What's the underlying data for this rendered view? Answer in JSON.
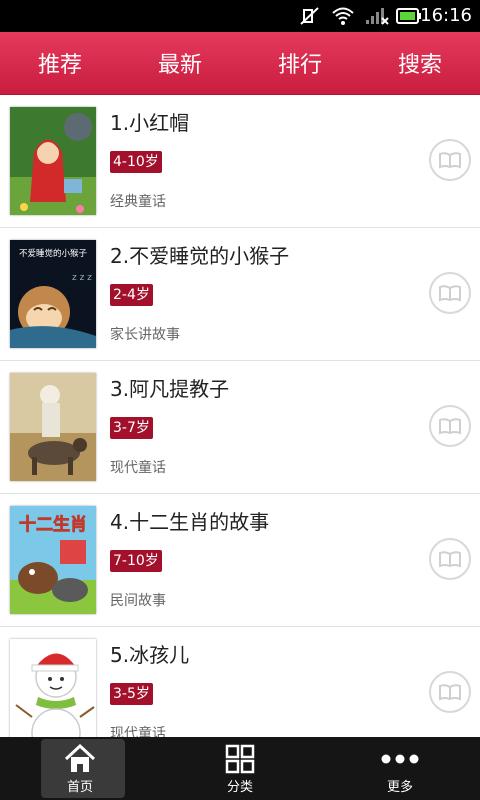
{
  "status_bar": {
    "time": "16:16",
    "icons": [
      "mute-icon",
      "wifi-icon",
      "signal-icon",
      "battery-icon"
    ]
  },
  "top_tabs": [
    {
      "label": "推荐"
    },
    {
      "label": "最新"
    },
    {
      "label": "排行"
    },
    {
      "label": "搜索"
    }
  ],
  "stories": [
    {
      "title": "1.小红帽",
      "age": "4-10岁",
      "category": "经典童话"
    },
    {
      "title": "2.不爱睡觉的小猴子",
      "age": "2-4岁",
      "category": "家长讲故事",
      "cover_text": "不爱睡觉的小猴子"
    },
    {
      "title": "3.阿凡提教子",
      "age": "3-7岁",
      "category": "现代童话"
    },
    {
      "title": "4.十二生肖的故事",
      "age": "7-10岁",
      "category": "民间故事",
      "cover_text": "十二生肖"
    },
    {
      "title": "5.冰孩儿",
      "age": "3-5岁",
      "category": "现代童话"
    }
  ],
  "bottom_nav": [
    {
      "label": "首页",
      "icon": "home-icon",
      "active": true
    },
    {
      "label": "分类",
      "icon": "grid-icon",
      "active": false
    },
    {
      "label": "更多",
      "icon": "more-icon",
      "active": false
    }
  ],
  "colors": {
    "header": "#d42a4e",
    "age_badge": "#a2102c",
    "bottom_bar": "#151515"
  }
}
